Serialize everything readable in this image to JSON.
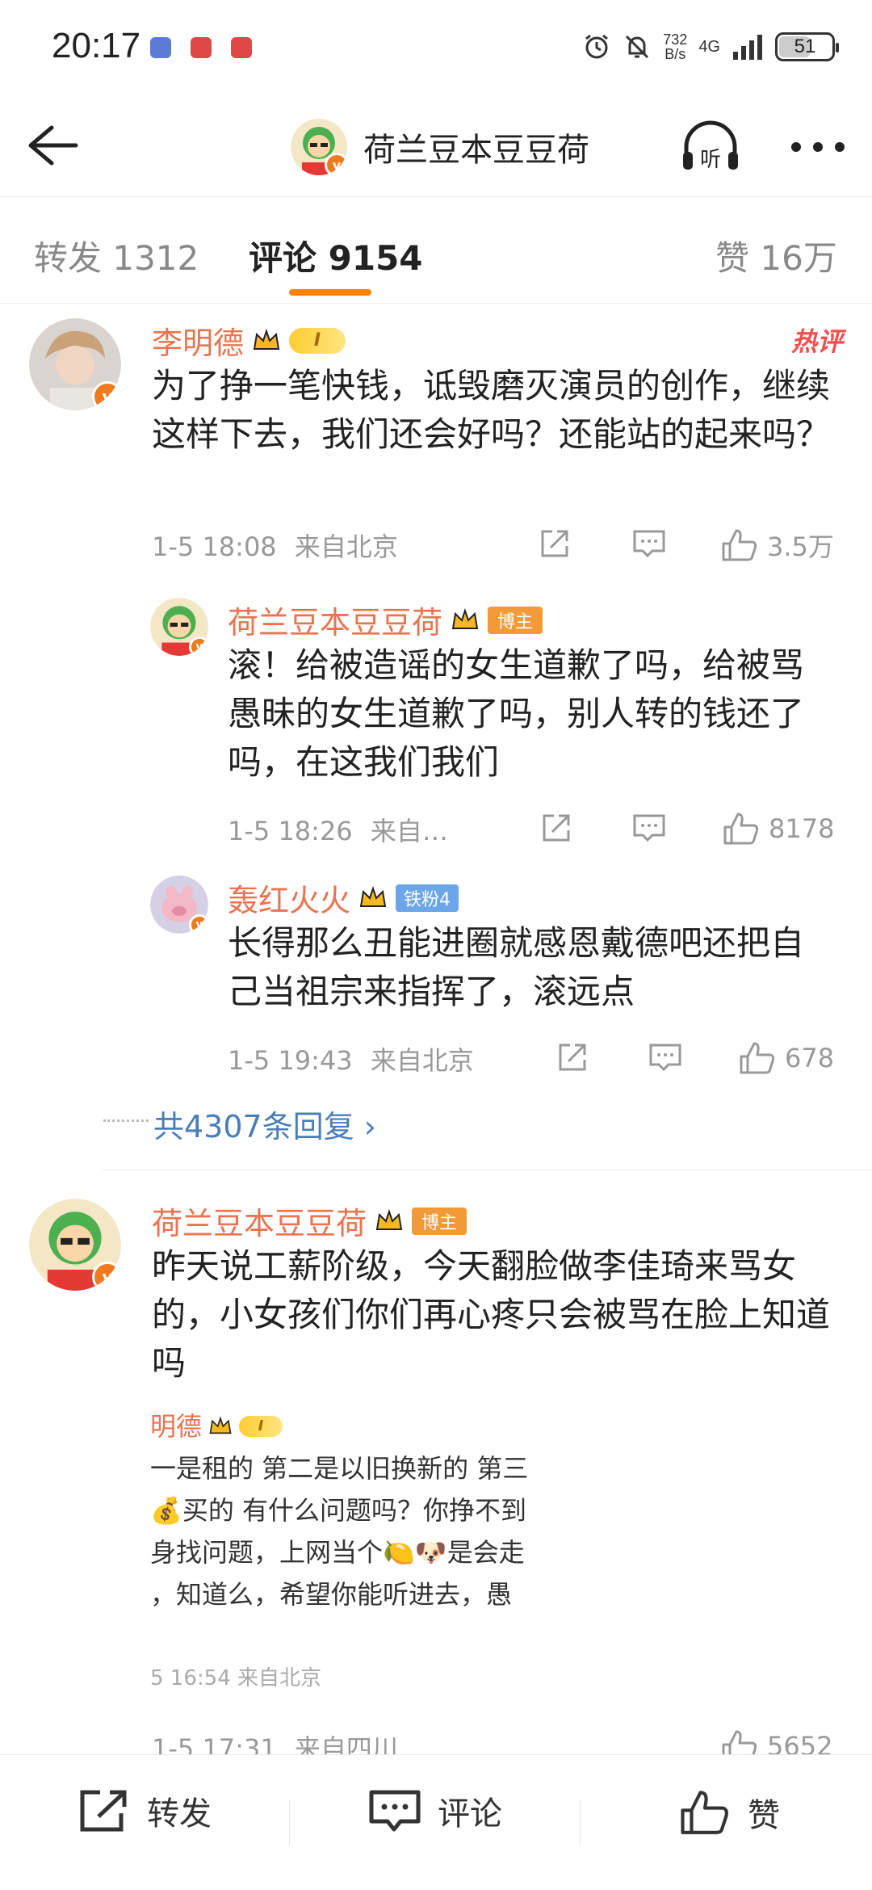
{
  "status_bar": {
    "time": "20:17",
    "net_speed_top": "732",
    "net_speed_bottom": "B/s",
    "network": "4G",
    "battery": "51"
  },
  "nav": {
    "title": "荷兰豆本豆豆荷",
    "listen_label": "听"
  },
  "tabs": {
    "repost": "转发 1312",
    "comments": "评论 9154",
    "likes": "赞 16万"
  },
  "comments": [
    {
      "user": "李明德",
      "level": "I",
      "hot": "热评",
      "text": "为了挣一笔快钱，诋毁磨灭演员的创作，继续这样下去，我们还会好吗？还能站的起来吗？",
      "time": "1-5 18:08",
      "location": "来自北京",
      "likes": "3.5万",
      "replies": [
        {
          "user": "荷兰豆本豆豆荷",
          "tag": "博主",
          "text": "滚！给被造谣的女生道歉了吗，给被骂愚昧的女生道歉了吗，别人转的钱还了吗，在这我们我们",
          "time": "1-5 18:26",
          "location": "来自…",
          "likes": "8178"
        },
        {
          "user": "轰红火火",
          "tag": "铁粉4",
          "text": "长得那么丑能进圈就感恩戴德吧还把自己当祖宗来指挥了，滚远点",
          "time": "1-5 19:43",
          "location": "来自北京",
          "likes": "678"
        }
      ],
      "more_replies": "共4307条回复 ›"
    },
    {
      "user": "荷兰豆本豆豆荷",
      "tag": "博主",
      "text": "昨天说工薪阶级，今天翻脸做李佳琦来骂女的，小女孩们你们再心疼只会被骂在脸上知道吗",
      "quote": {
        "user": "明德",
        "level": "I",
        "line1": "一是租的 第二是以旧换新的 第三",
        "line2": "💰买的 有什么问题吗？你挣不到",
        "line3": "身找问题，上网当个🍋🐶是会走",
        "line4": "，知道么，希望你能听进去，愚",
        "time": "5 16:54",
        "location": "来自北京"
      },
      "time": "1-5 17:31",
      "location": "来自四川",
      "likes": "5652"
    }
  ],
  "bottom_bar": {
    "repost": "转发",
    "comment": "评论",
    "like": "赞"
  },
  "colors": {
    "accent": "#ff8200",
    "username": "#eb7350",
    "link": "#4a7eb8",
    "hot": "#f24f4f"
  }
}
